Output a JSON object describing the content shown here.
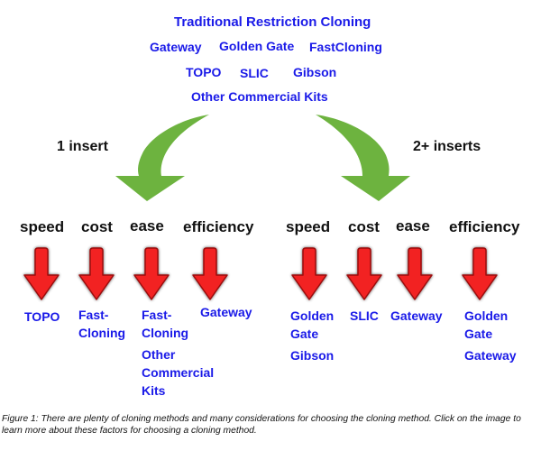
{
  "methods": {
    "row1": [
      "Traditional Restriction Cloning"
    ],
    "row2": [
      "Gateway",
      "Golden Gate",
      "FastCloning"
    ],
    "row3": [
      "TOPO",
      "SLIC",
      "Gibson"
    ],
    "row4": [
      "Other Commercial Kits"
    ]
  },
  "branches": {
    "left": {
      "label": "1 insert"
    },
    "right": {
      "label": "2+ inserts"
    }
  },
  "criteria": {
    "left": [
      {
        "header": "speed",
        "results": [
          "TOPO"
        ]
      },
      {
        "header": "cost",
        "results": [
          "Fast-\nCloning"
        ]
      },
      {
        "header": "ease",
        "results": [
          "Fast-\nCloning",
          "Other\nCommercial\nKits"
        ]
      },
      {
        "header": "efficiency",
        "results": [
          "Gateway"
        ]
      }
    ],
    "right": [
      {
        "header": "speed",
        "results": [
          "Golden\nGate",
          "Gibson"
        ]
      },
      {
        "header": "cost",
        "results": [
          "SLIC"
        ]
      },
      {
        "header": "ease",
        "results": [
          "Gateway"
        ]
      },
      {
        "header": "efficiency",
        "results": [
          "Golden\nGate",
          "Gateway"
        ]
      }
    ]
  },
  "colors": {
    "method_text": "#1a1ae8",
    "green_arrow": "#6db33f",
    "red_arrow": "#f22222",
    "red_arrow_outline": "#9a0c0c"
  },
  "caption": "Figure 1: There are plenty of cloning methods and many considerations for choosing the cloning method. Click on the image to learn more about these factors for choosing a cloning method."
}
